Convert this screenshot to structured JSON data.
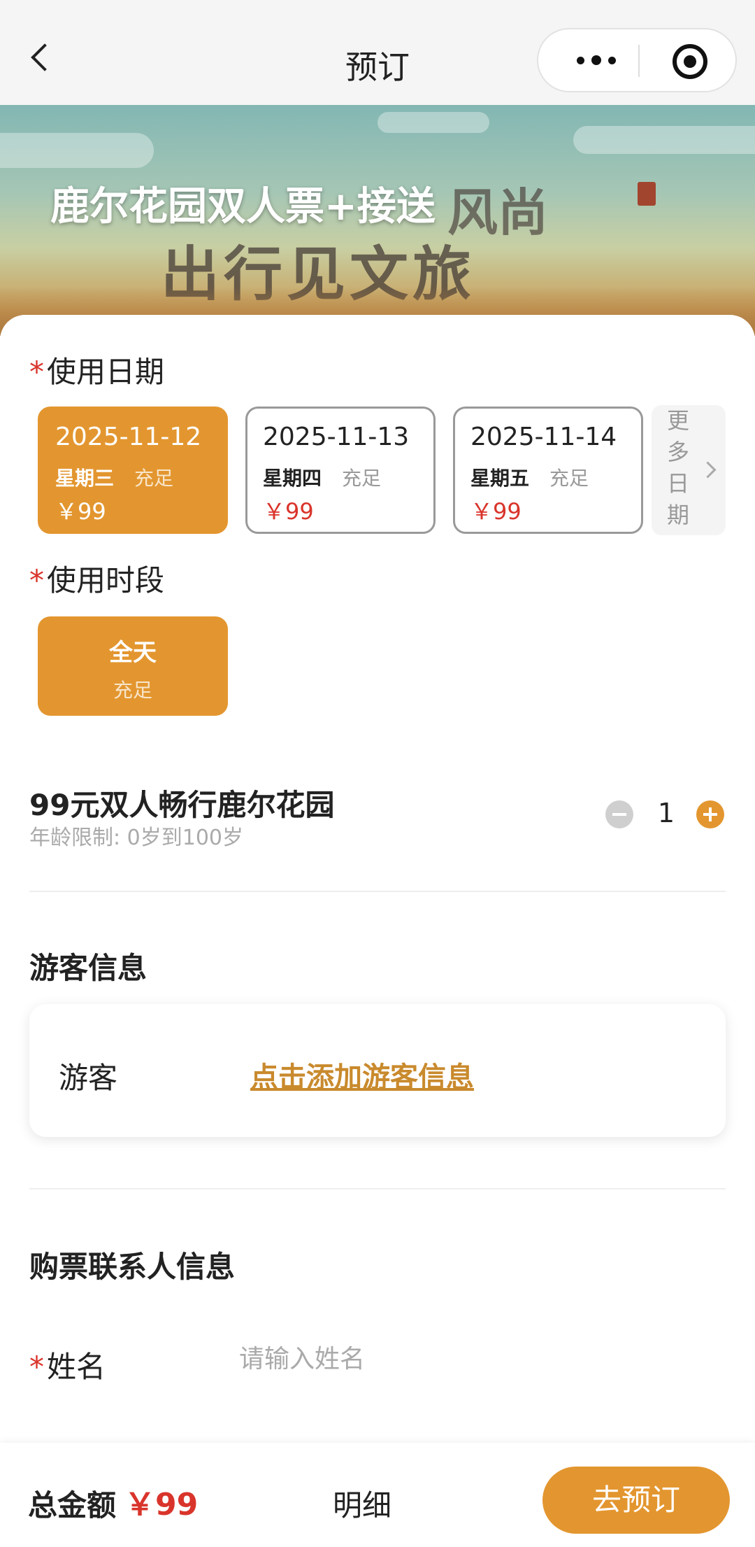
{
  "nav": {
    "title": "预订"
  },
  "banner": {
    "title": "鹿尔花园双人票+接送",
    "art_text": "出行见文旅",
    "art_text_2": "风尚"
  },
  "date_section": {
    "label": "使用日期",
    "dates": [
      {
        "date": "2025-11-12",
        "weekday": "星期三",
        "status": "充足",
        "price": "￥99",
        "selected": true
      },
      {
        "date": "2025-11-13",
        "weekday": "星期四",
        "status": "充足",
        "price": "￥99",
        "selected": false
      },
      {
        "date": "2025-11-14",
        "weekday": "星期五",
        "status": "充足",
        "price": "￥99",
        "selected": false
      }
    ],
    "more": "更多日期"
  },
  "slot_section": {
    "label": "使用时段",
    "slots": [
      {
        "name": "全天",
        "status": "充足",
        "selected": true
      }
    ]
  },
  "product": {
    "name": "99元双人畅行鹿尔花园",
    "age_limit": "年龄限制: 0岁到100岁",
    "quantity": "1"
  },
  "visitor_section": {
    "title": "游客信息",
    "row_label": "游客",
    "add_link": "点击添加游客信息"
  },
  "contact_section": {
    "title": "购票联系人信息",
    "name_label": "姓名",
    "name_placeholder": "请输入姓名",
    "name_value": ""
  },
  "footer": {
    "total_label": "总金额",
    "total_value": "￥99",
    "detail_label": "明细",
    "book_label": "去预订"
  },
  "colors": {
    "accent": "#e3962f",
    "price_red": "#d9342b",
    "link": "#c98a2d"
  },
  "icons": {
    "back": "chevron-left-icon",
    "more": "more-dots-icon",
    "close": "target-icon",
    "arrow": "chevron-right-icon"
  }
}
